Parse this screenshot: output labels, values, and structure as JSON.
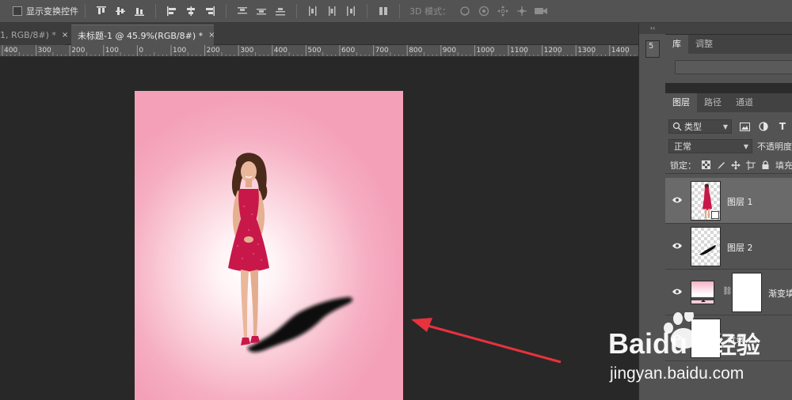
{
  "options_bar": {
    "show_transform_controls": "显示变换控件",
    "mode_label": "3D 模式："
  },
  "tabs": [
    {
      "label": "1, RGB/8#) *",
      "close": "×"
    },
    {
      "label": "未标题-1 @ 45.9%(RGB/8#) *",
      "close": "×"
    }
  ],
  "ruler": {
    "labels": [
      "400",
      "300",
      "200",
      "100",
      "0",
      "100",
      "200",
      "300",
      "400",
      "500",
      "600",
      "700",
      "800",
      "900",
      "1000",
      "1100",
      "1200",
      "1300",
      "1400"
    ]
  },
  "dock": {
    "collapse": "‹‹",
    "history_glyph": "5"
  },
  "library_panel": {
    "tabs": [
      "库",
      "调整"
    ],
    "active_tab": "库"
  },
  "layers_panel": {
    "tabs": [
      "图层",
      "路径",
      "通道"
    ],
    "active_tab": "图层",
    "kind_filter": "类型",
    "filter_text_icon": "T",
    "blend_mode": "正常",
    "opacity_label": "不透明度",
    "lock_label": "锁定：",
    "fill_label": "填充",
    "layers": [
      {
        "name": "图层 1",
        "selected": true,
        "thumb": "model"
      },
      {
        "name": "图层 2",
        "selected": false,
        "thumb": "shadow"
      },
      {
        "name": "渐变填",
        "selected": false,
        "thumb": "gradient"
      },
      {
        "name": "背景",
        "selected": false,
        "thumb": "white"
      }
    ]
  },
  "watermark": {
    "brand": "Baidu",
    "brand_cn": "经验",
    "url": "jingyan.baidu.com"
  },
  "colors": {
    "canvas_pink": "#f3a0b8",
    "arrow_red": "#e8323c",
    "dress": "#c8184a"
  }
}
